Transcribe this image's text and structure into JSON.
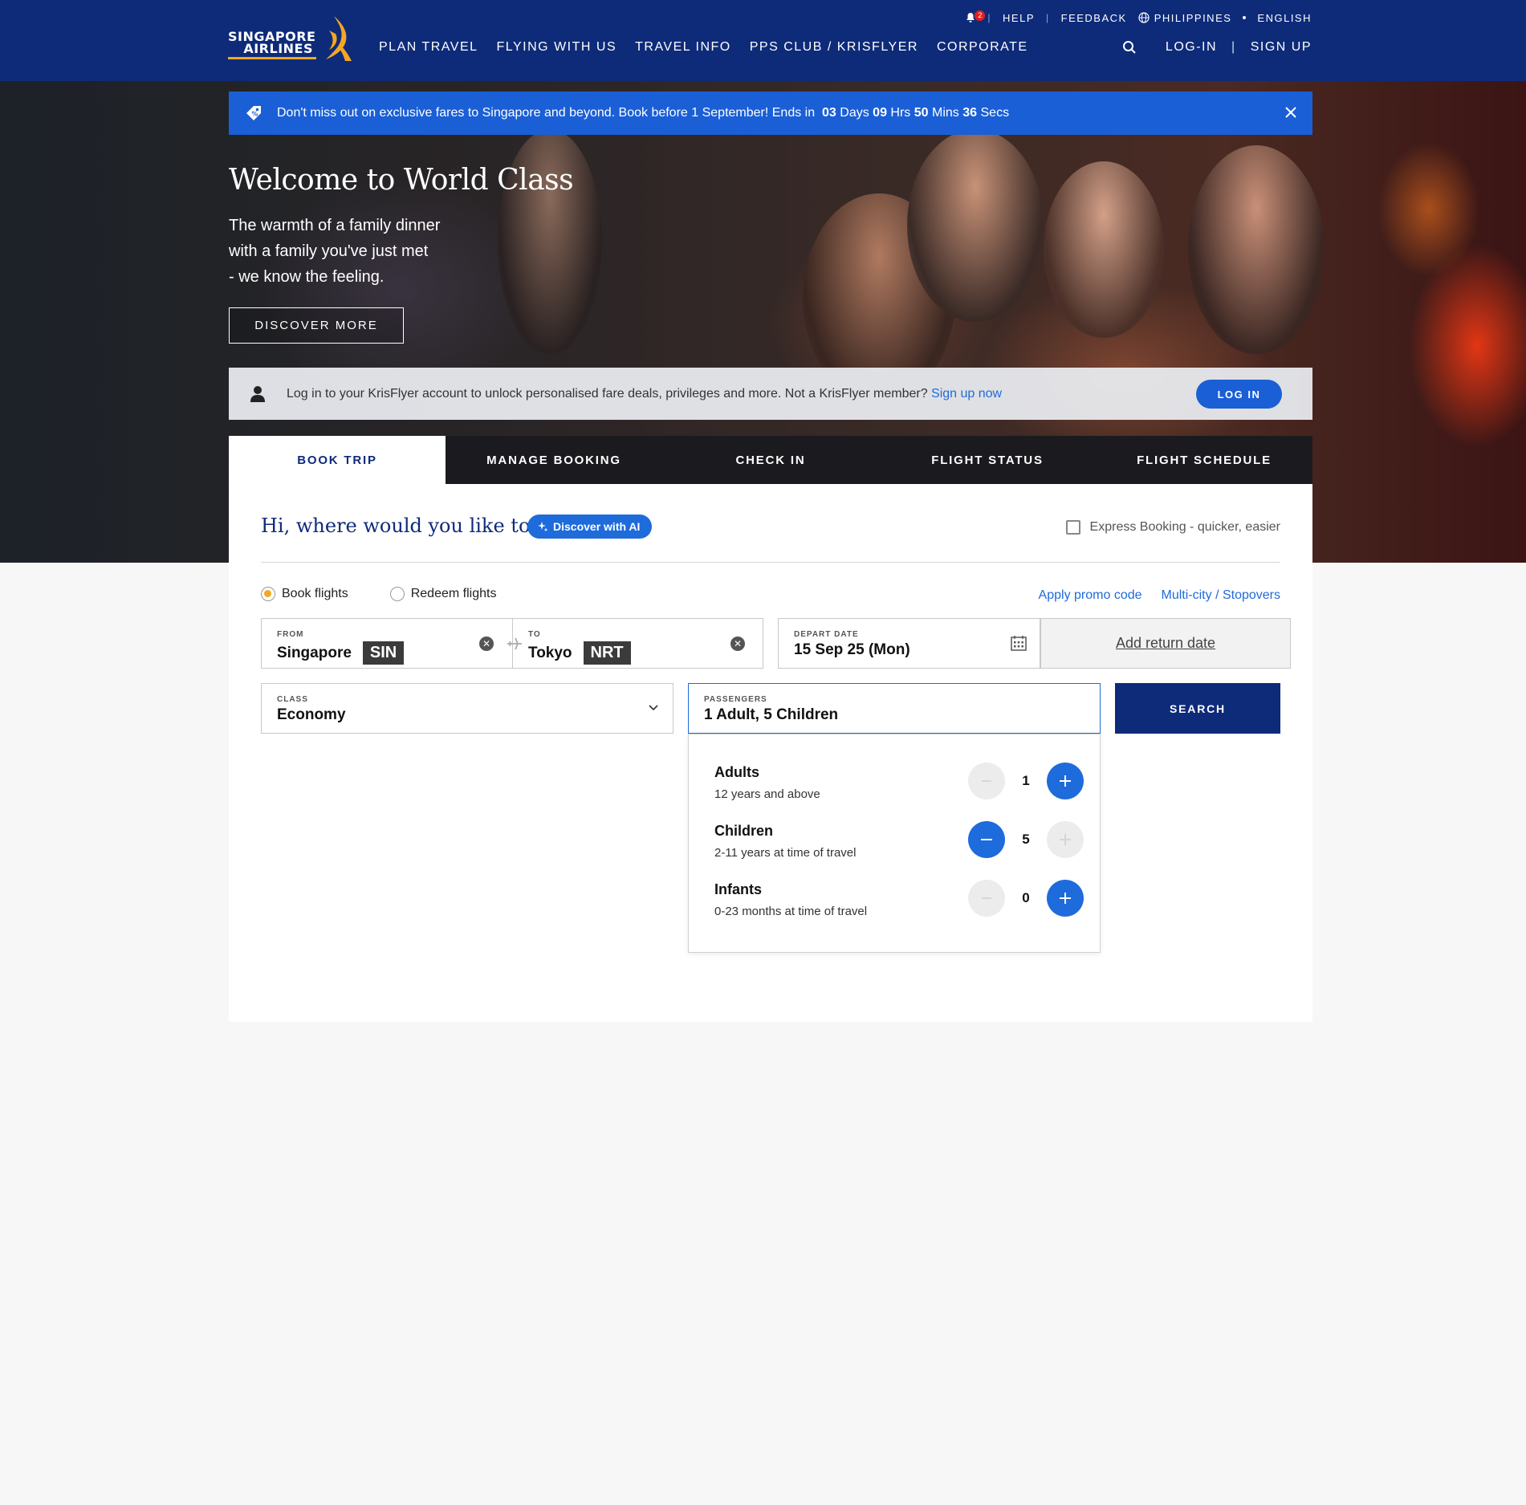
{
  "header": {
    "logo_line1": "SINGAPORE",
    "logo_line2": "AIRLINES",
    "notification_count": "2",
    "help": "HELP",
    "feedback": "FEEDBACK",
    "country": "PHILIPPINES",
    "language": "ENGLISH",
    "nav": [
      "PLAN TRAVEL",
      "FLYING WITH US",
      "TRAVEL INFO",
      "PPS CLUB / KRISFLYER",
      "CORPORATE"
    ],
    "login": "LOG-IN",
    "signup": "SIGN UP",
    "icons": [
      "bell-icon",
      "globe-icon",
      "search-icon"
    ],
    "brand_color": "#0e2b7a",
    "accent_color": "#f5a623"
  },
  "promo": {
    "text": "Don't miss out on exclusive fares to Singapore and beyond. Book before 1 September! Ends in",
    "days": "03",
    "days_label": "Days",
    "hrs": "09",
    "hrs_label": "Hrs",
    "mins": "50",
    "mins_label": "Mins",
    "secs": "36",
    "secs_label": "Secs",
    "color": "#1a5fd6"
  },
  "hero": {
    "title": "Welcome to World Class",
    "subtitle_lines": [
      "The warmth of a family dinner",
      "with a family you've just met",
      "- we know the feeling."
    ],
    "cta": "DISCOVER MORE"
  },
  "krisflyer": {
    "text": "Log in to your KrisFlyer account to unlock personalised fare deals, privileges and more. Not a KrisFlyer member?",
    "link": "Sign up now",
    "button": "LOG IN"
  },
  "tabs": [
    "BOOK TRIP",
    "MANAGE BOOKING",
    "CHECK IN",
    "FLIGHT STATUS",
    "FLIGHT SCHEDULE"
  ],
  "booking": {
    "greeting": "Hi, where would you like to go?",
    "ai_chip": "Discover with AI",
    "express": "Express Booking - quicker, easier",
    "radio_book": "Book flights",
    "radio_redeem": "Redeem flights",
    "promo_link": "Apply promo code",
    "multicity_link": "Multi-city / Stopovers",
    "from_label": "FROM",
    "from_city": "Singapore",
    "from_code": "SIN",
    "to_label": "TO",
    "to_city": "Tokyo",
    "to_code": "NRT",
    "depart_label": "DEPART DATE",
    "depart_value": "15 Sep 25 (Mon)",
    "return_placeholder": "Add return date",
    "class_label": "CLASS",
    "class_value": "Economy",
    "pax_label": "PASSENGERS",
    "pax_value": "1 Adult, 5 Children",
    "search": "SEARCH"
  },
  "passengers": [
    {
      "name": "Adults",
      "desc": "12 years and above",
      "count": "1",
      "minus_enabled": false,
      "plus_enabled": true
    },
    {
      "name": "Children",
      "desc": "2-11 years at time of travel",
      "count": "5",
      "minus_enabled": true,
      "plus_enabled": false
    },
    {
      "name": "Infants",
      "desc": "0-23 months at time of travel",
      "count": "0",
      "minus_enabled": false,
      "plus_enabled": true
    }
  ]
}
